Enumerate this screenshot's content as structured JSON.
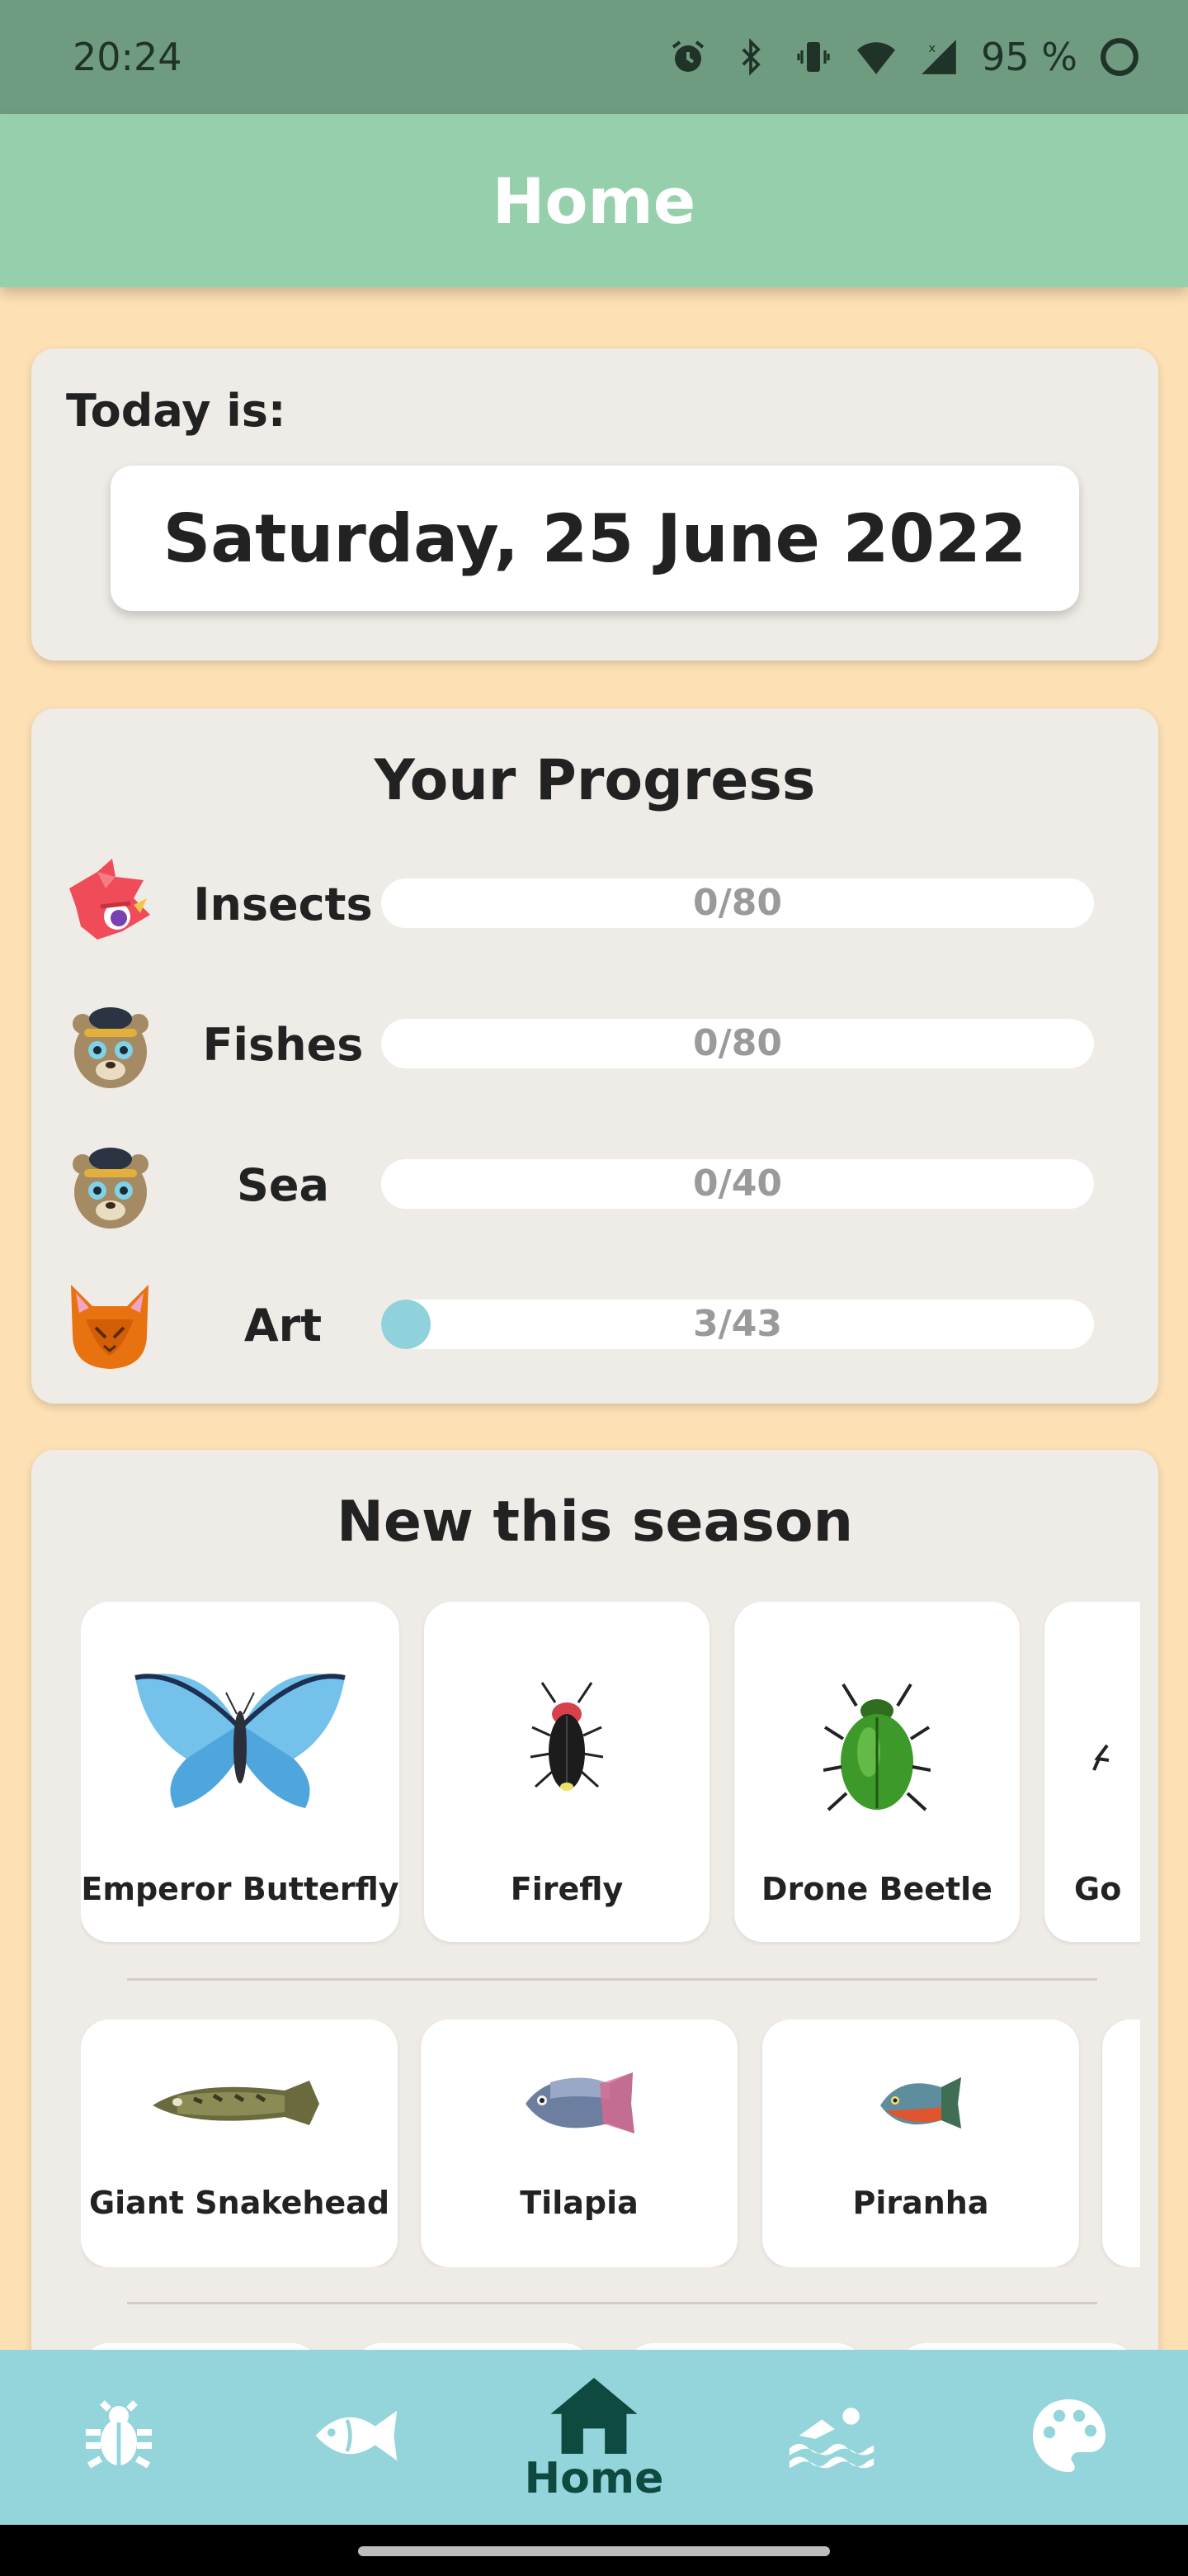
{
  "status_bar": {
    "time": "20:24",
    "battery": "95 %",
    "icons": [
      "alarm-icon",
      "bluetooth-icon",
      "vibrate-icon",
      "wifi-icon",
      "signal-icon",
      "battery-icon"
    ]
  },
  "app_bar": {
    "title": "Home"
  },
  "today": {
    "label": "Today is:",
    "date": "Saturday, 25 June 2022"
  },
  "progress": {
    "title": "Your Progress",
    "rows": [
      {
        "label": "Insects",
        "text": "0/80",
        "done": 0,
        "total": 80,
        "avatar": "insect-villager-icon"
      },
      {
        "label": "Fishes",
        "text": "0/80",
        "done": 0,
        "total": 80,
        "avatar": "fish-villager-icon"
      },
      {
        "label": "Sea",
        "text": "0/40",
        "done": 0,
        "total": 40,
        "avatar": "sea-villager-icon"
      },
      {
        "label": "Art",
        "text": "3/43",
        "done": 3,
        "total": 43,
        "avatar": "art-villager-icon"
      }
    ],
    "fill_color": "#8fd2db"
  },
  "season": {
    "title": "New this season",
    "insects": [
      {
        "name": "Emperor Butterfly",
        "icon": "emperor-butterfly-icon"
      },
      {
        "name": "Firefly",
        "icon": "firefly-icon"
      },
      {
        "name": "Drone Beetle",
        "icon": "drone-beetle-icon"
      },
      {
        "name": "Go",
        "icon": "goliath-beetle-icon"
      }
    ],
    "fishes": [
      {
        "name": "Giant Snakehead",
        "icon": "giant-snakehead-icon"
      },
      {
        "name": "Tilapia",
        "icon": "tilapia-icon"
      },
      {
        "name": "Piranha",
        "icon": "piranha-icon"
      }
    ]
  },
  "bottom_nav": {
    "items": [
      {
        "icon": "bug-icon"
      },
      {
        "icon": "fish-icon"
      },
      {
        "icon": "home-icon",
        "label": "Home"
      },
      {
        "icon": "swimmer-icon"
      },
      {
        "icon": "palette-icon"
      }
    ],
    "active": "Home"
  },
  "colors": {
    "background": "#fde0b4",
    "status_bar": "#6f9b81",
    "app_bar": "#96cfab",
    "card": "#efebe6",
    "bottom_nav": "#94d5dc",
    "nav_active": "#0e4a3f"
  }
}
